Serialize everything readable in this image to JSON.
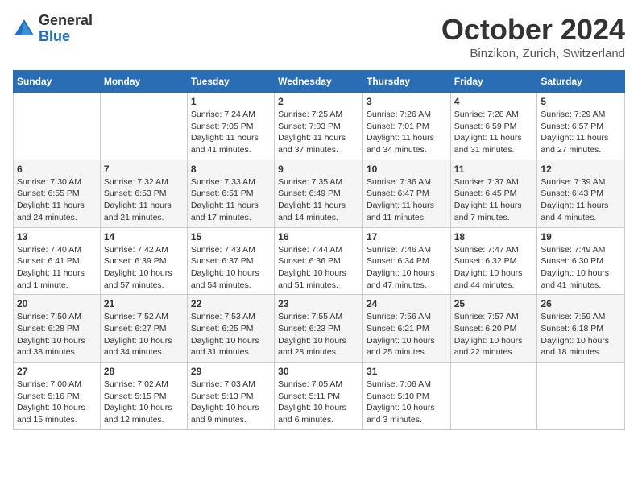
{
  "logo": {
    "general": "General",
    "blue": "Blue"
  },
  "header": {
    "month": "October 2024",
    "location": "Binzikon, Zurich, Switzerland"
  },
  "weekdays": [
    "Sunday",
    "Monday",
    "Tuesday",
    "Wednesday",
    "Thursday",
    "Friday",
    "Saturday"
  ],
  "weeks": [
    [
      {
        "day": "",
        "info": ""
      },
      {
        "day": "",
        "info": ""
      },
      {
        "day": "1",
        "info": "Sunrise: 7:24 AM\nSunset: 7:05 PM\nDaylight: 11 hours and 41 minutes."
      },
      {
        "day": "2",
        "info": "Sunrise: 7:25 AM\nSunset: 7:03 PM\nDaylight: 11 hours and 37 minutes."
      },
      {
        "day": "3",
        "info": "Sunrise: 7:26 AM\nSunset: 7:01 PM\nDaylight: 11 hours and 34 minutes."
      },
      {
        "day": "4",
        "info": "Sunrise: 7:28 AM\nSunset: 6:59 PM\nDaylight: 11 hours and 31 minutes."
      },
      {
        "day": "5",
        "info": "Sunrise: 7:29 AM\nSunset: 6:57 PM\nDaylight: 11 hours and 27 minutes."
      }
    ],
    [
      {
        "day": "6",
        "info": "Sunrise: 7:30 AM\nSunset: 6:55 PM\nDaylight: 11 hours and 24 minutes."
      },
      {
        "day": "7",
        "info": "Sunrise: 7:32 AM\nSunset: 6:53 PM\nDaylight: 11 hours and 21 minutes."
      },
      {
        "day": "8",
        "info": "Sunrise: 7:33 AM\nSunset: 6:51 PM\nDaylight: 11 hours and 17 minutes."
      },
      {
        "day": "9",
        "info": "Sunrise: 7:35 AM\nSunset: 6:49 PM\nDaylight: 11 hours and 14 minutes."
      },
      {
        "day": "10",
        "info": "Sunrise: 7:36 AM\nSunset: 6:47 PM\nDaylight: 11 hours and 11 minutes."
      },
      {
        "day": "11",
        "info": "Sunrise: 7:37 AM\nSunset: 6:45 PM\nDaylight: 11 hours and 7 minutes."
      },
      {
        "day": "12",
        "info": "Sunrise: 7:39 AM\nSunset: 6:43 PM\nDaylight: 11 hours and 4 minutes."
      }
    ],
    [
      {
        "day": "13",
        "info": "Sunrise: 7:40 AM\nSunset: 6:41 PM\nDaylight: 11 hours and 1 minute."
      },
      {
        "day": "14",
        "info": "Sunrise: 7:42 AM\nSunset: 6:39 PM\nDaylight: 10 hours and 57 minutes."
      },
      {
        "day": "15",
        "info": "Sunrise: 7:43 AM\nSunset: 6:37 PM\nDaylight: 10 hours and 54 minutes."
      },
      {
        "day": "16",
        "info": "Sunrise: 7:44 AM\nSunset: 6:36 PM\nDaylight: 10 hours and 51 minutes."
      },
      {
        "day": "17",
        "info": "Sunrise: 7:46 AM\nSunset: 6:34 PM\nDaylight: 10 hours and 47 minutes."
      },
      {
        "day": "18",
        "info": "Sunrise: 7:47 AM\nSunset: 6:32 PM\nDaylight: 10 hours and 44 minutes."
      },
      {
        "day": "19",
        "info": "Sunrise: 7:49 AM\nSunset: 6:30 PM\nDaylight: 10 hours and 41 minutes."
      }
    ],
    [
      {
        "day": "20",
        "info": "Sunrise: 7:50 AM\nSunset: 6:28 PM\nDaylight: 10 hours and 38 minutes."
      },
      {
        "day": "21",
        "info": "Sunrise: 7:52 AM\nSunset: 6:27 PM\nDaylight: 10 hours and 34 minutes."
      },
      {
        "day": "22",
        "info": "Sunrise: 7:53 AM\nSunset: 6:25 PM\nDaylight: 10 hours and 31 minutes."
      },
      {
        "day": "23",
        "info": "Sunrise: 7:55 AM\nSunset: 6:23 PM\nDaylight: 10 hours and 28 minutes."
      },
      {
        "day": "24",
        "info": "Sunrise: 7:56 AM\nSunset: 6:21 PM\nDaylight: 10 hours and 25 minutes."
      },
      {
        "day": "25",
        "info": "Sunrise: 7:57 AM\nSunset: 6:20 PM\nDaylight: 10 hours and 22 minutes."
      },
      {
        "day": "26",
        "info": "Sunrise: 7:59 AM\nSunset: 6:18 PM\nDaylight: 10 hours and 18 minutes."
      }
    ],
    [
      {
        "day": "27",
        "info": "Sunrise: 7:00 AM\nSunset: 5:16 PM\nDaylight: 10 hours and 15 minutes."
      },
      {
        "day": "28",
        "info": "Sunrise: 7:02 AM\nSunset: 5:15 PM\nDaylight: 10 hours and 12 minutes."
      },
      {
        "day": "29",
        "info": "Sunrise: 7:03 AM\nSunset: 5:13 PM\nDaylight: 10 hours and 9 minutes."
      },
      {
        "day": "30",
        "info": "Sunrise: 7:05 AM\nSunset: 5:11 PM\nDaylight: 10 hours and 6 minutes."
      },
      {
        "day": "31",
        "info": "Sunrise: 7:06 AM\nSunset: 5:10 PM\nDaylight: 10 hours and 3 minutes."
      },
      {
        "day": "",
        "info": ""
      },
      {
        "day": "",
        "info": ""
      }
    ]
  ]
}
